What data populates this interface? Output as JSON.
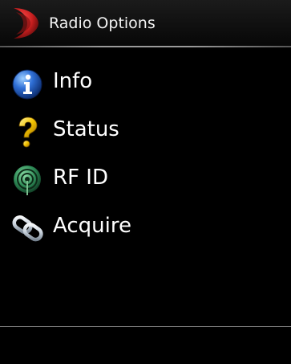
{
  "header": {
    "title": "Radio Options",
    "logo_icon": "red-arc-logo-icon"
  },
  "menu": {
    "items": [
      {
        "label": "Info",
        "icon": "info-icon"
      },
      {
        "label": "Status",
        "icon": "question-mark-icon"
      },
      {
        "label": "RF ID",
        "icon": "rf-antenna-icon"
      },
      {
        "label": "Acquire",
        "icon": "chain-link-icon"
      }
    ]
  },
  "colors": {
    "background": "#000000",
    "text": "#ffffff",
    "logo_red": "#c41e1e",
    "info_blue": "#2f6fd6",
    "status_yellow": "#f2c200",
    "rf_green": "#2e8b57",
    "link_silver": "#c8d2dc"
  }
}
